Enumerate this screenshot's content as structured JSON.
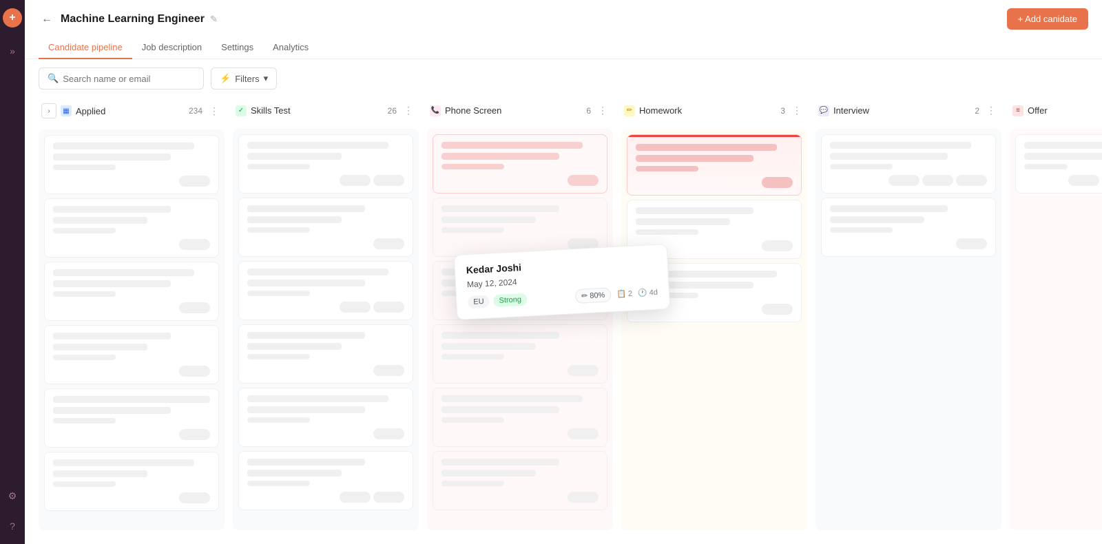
{
  "sidebar": {
    "logo": "+",
    "expand_icon": "»",
    "settings_icon": "⚙",
    "help_icon": "?"
  },
  "header": {
    "title": "Machine Learning Engineer",
    "back_label": "←",
    "edit_icon": "✎",
    "add_candidate_label": "+ Add canidate"
  },
  "tabs": [
    {
      "id": "candidate-pipeline",
      "label": "Candidate pipeline",
      "active": true
    },
    {
      "id": "job-description",
      "label": "Job description",
      "active": false
    },
    {
      "id": "settings",
      "label": "Settings",
      "active": false
    },
    {
      "id": "analytics",
      "label": "Analytics",
      "active": false
    }
  ],
  "toolbar": {
    "search_placeholder": "Search name or email",
    "filter_label": "Filters"
  },
  "columns": [
    {
      "id": "applied",
      "title": "Applied",
      "count": 234,
      "icon_type": "blue",
      "icon_char": "▦"
    },
    {
      "id": "skills-test",
      "title": "Skills Test",
      "count": 26,
      "icon_type": "green",
      "icon_char": "✓"
    },
    {
      "id": "phone-screen",
      "title": "Phone Screen",
      "count": 6,
      "icon_type": "phone",
      "icon_char": "📞"
    },
    {
      "id": "homework",
      "title": "Homework",
      "count": 3,
      "icon_type": "pencil",
      "icon_char": "✏"
    },
    {
      "id": "interview",
      "title": "Interview",
      "count": 2,
      "icon_type": "chat",
      "icon_char": "💬"
    },
    {
      "id": "offer",
      "title": "Offer",
      "count": "",
      "icon_type": "offer",
      "icon_char": "≡"
    }
  ],
  "highlighted_card": {
    "name": "Kedar Joshi",
    "date": "May 12, 2024",
    "score": "80%",
    "score_icon": "✏",
    "tags": [
      "EU",
      "Strong"
    ],
    "count": "2",
    "time": "4d"
  }
}
